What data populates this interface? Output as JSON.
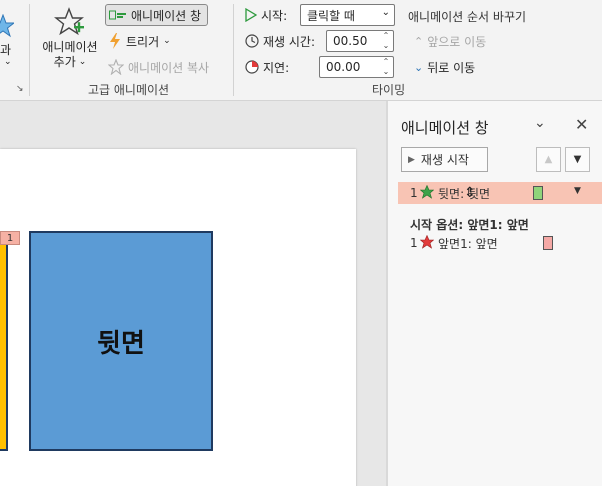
{
  "ribbon": {
    "partial_left_label": "과",
    "add_animation_label_line1": "애니메이션",
    "add_animation_label_line2": "추가",
    "animation_pane_button": "애니메이션 창",
    "trigger_button": "트리거",
    "animation_painter": "애니메이션 복사",
    "advanced_group_label": "고급 애니메이션",
    "start_label": "시작:",
    "start_value": "클릭할 때",
    "duration_label": "재생 시간:",
    "duration_value": "00.50",
    "delay_label": "지연:",
    "delay_value": "00.00",
    "reorder_title": "애니메이션 순서 바꾸기",
    "move_earlier": "앞으로 이동",
    "move_later": "뒤로 이동",
    "timing_group_label": "타이밍"
  },
  "slide": {
    "shape_text": "뒷면",
    "tag_number": "1"
  },
  "pane": {
    "title": "애니메이션 창",
    "play_label": "재생 시작",
    "items": [
      {
        "number": "1",
        "label": "뒷면: 뒷면",
        "bar_color": "#8fd47a",
        "icon_color": "#3ea34a"
      },
      {
        "number": "1",
        "label": "앞면1: 앞면",
        "bar_color": "#f5a9a6",
        "icon_color": "#e23b3b"
      }
    ],
    "group_heading": "시작 옵션: 앞면1: 앞면"
  },
  "colors": {
    "shape_fill": "#5b9bd5",
    "shape_border": "#1f3a60",
    "yellow_shape": "#ffc000",
    "selected_item": "#f8c4b4"
  }
}
